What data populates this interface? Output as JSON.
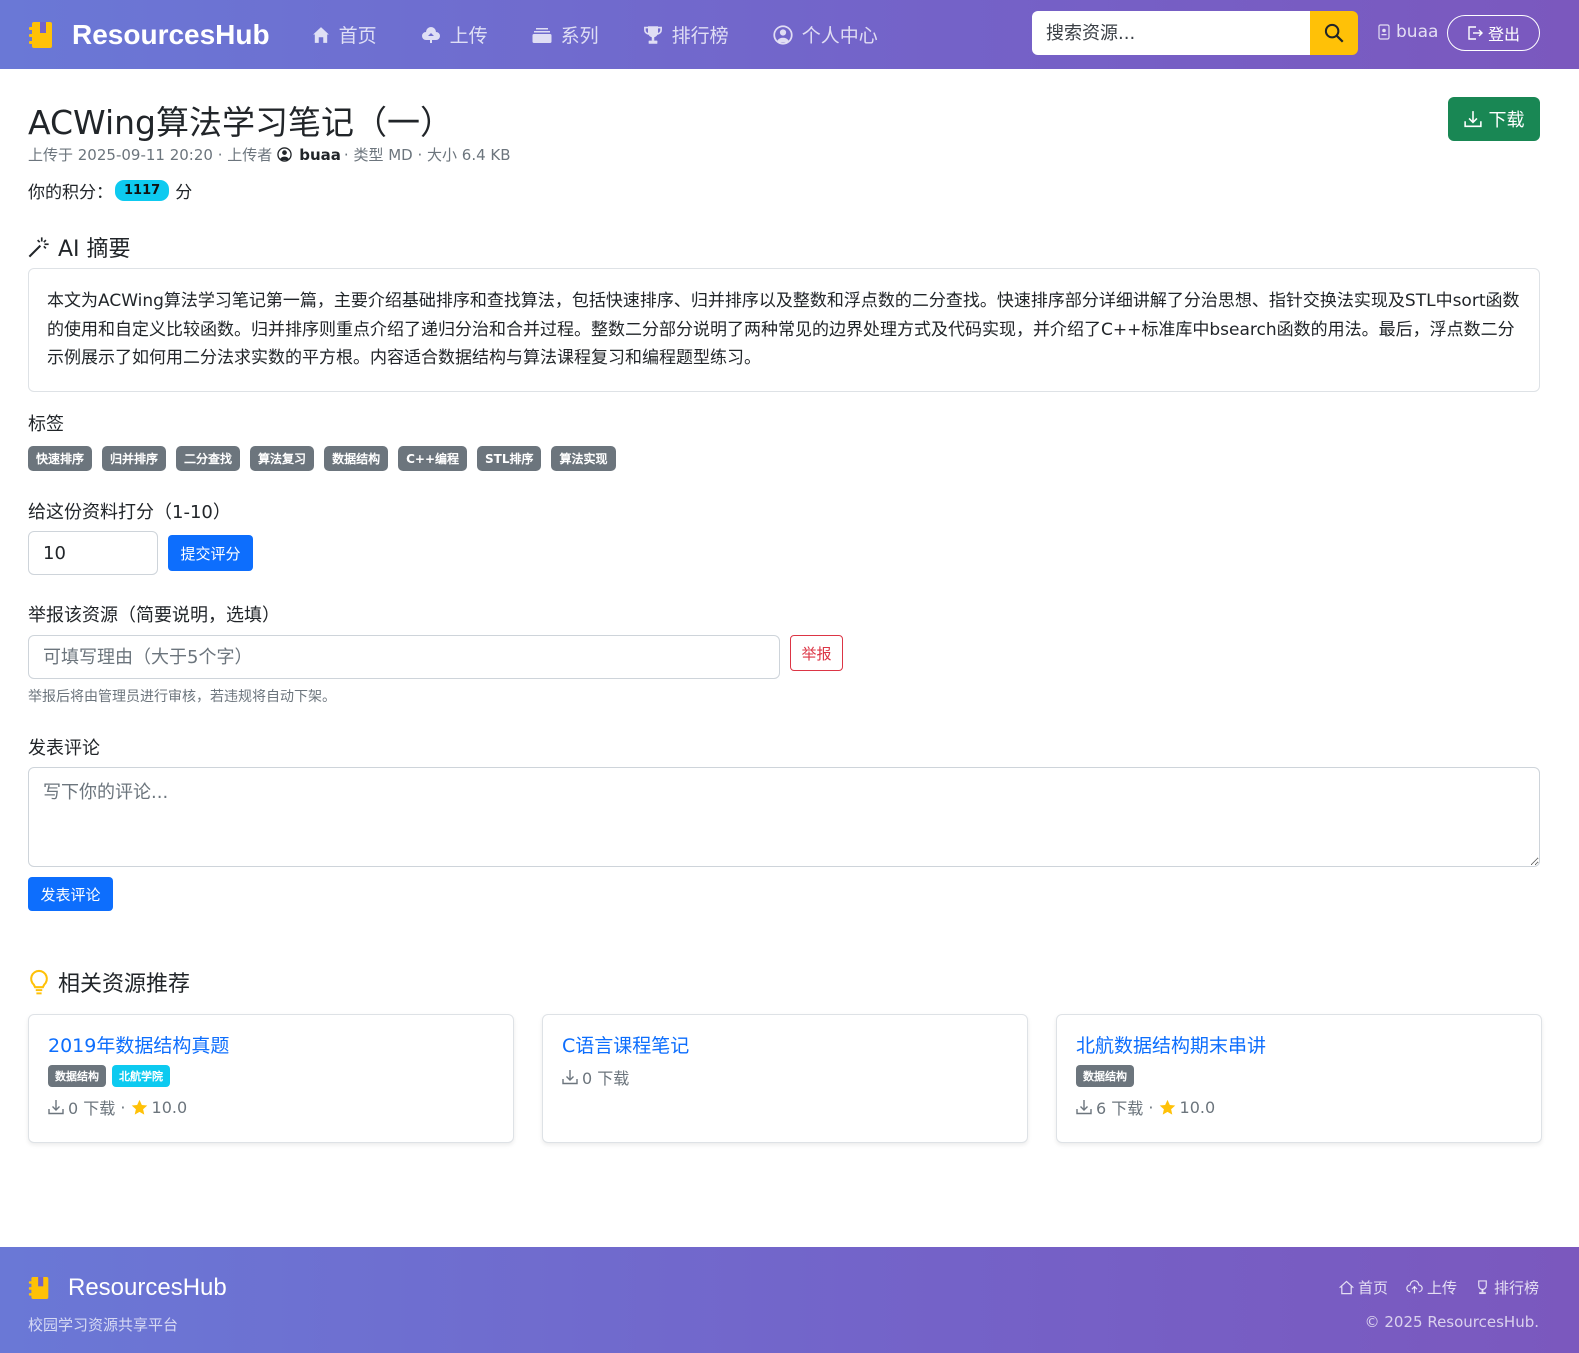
{
  "navbar": {
    "brand": "ResourcesHub",
    "links": [
      {
        "label": "首页",
        "icon": "home-icon"
      },
      {
        "label": "上传",
        "icon": "cloud-upload-icon"
      },
      {
        "label": "系列",
        "icon": "collection-icon"
      },
      {
        "label": "排行榜",
        "icon": "trophy-icon"
      },
      {
        "label": "个人中心",
        "icon": "person-circle-icon"
      }
    ],
    "search_placeholder": "搜索资源...",
    "username": "buaa",
    "logout_label": "登出"
  },
  "resource": {
    "title": "ACWing算法学习笔记（一）",
    "download_label": "下载",
    "meta_uploaded_prefix": "上传于 2025-09-11 20:20 · 上传者",
    "uploader": "buaa",
    "meta_suffix": "· 类型 MD · 大小 6.4 KB",
    "points_label": "你的积分：",
    "points_value": "1117",
    "points_unit": "分"
  },
  "ai_summary": {
    "heading": "AI 摘要",
    "text": "本文为ACWing算法学习笔记第一篇，主要介绍基础排序和查找算法，包括快速排序、归并排序以及整数和浮点数的二分查找。快速排序部分详细讲解了分治思想、指针交换法实现及STL中sort函数的使用和自定义比较函数。归并排序则重点介绍了递归分治和合并过程。整数二分部分说明了两种常见的边界处理方式及代码实现，并介绍了C++标准库中bsearch函数的用法。最后，浮点数二分示例展示了如何用二分法求实数的平方根。内容适合数据结构与算法课程复习和编程题型练习。"
  },
  "tags": {
    "heading": "标签",
    "items": [
      "快速排序",
      "归并排序",
      "二分查找",
      "算法复习",
      "数据结构",
      "C++编程",
      "STL排序",
      "算法实现"
    ]
  },
  "rating": {
    "label": "给这份资料打分（1-10）",
    "value": "10",
    "submit_label": "提交评分"
  },
  "report": {
    "label": "举报该资源（简要说明，选填）",
    "placeholder": "可填写理由（大于5个字）",
    "button_label": "举报",
    "hint": "举报后将由管理员进行审核，若违规将自动下架。"
  },
  "comment": {
    "label": "发表评论",
    "placeholder": "写下你的评论...",
    "submit_label": "发表评论"
  },
  "related": {
    "heading": "相关资源推荐",
    "cards": [
      {
        "title": "2019年数据结构真题",
        "tags": [
          {
            "label": "数据结构",
            "color": "#6c757d"
          },
          {
            "label": "北航学院",
            "color": "#0dcaf0"
          }
        ],
        "downloads": "0 下载",
        "has_rating": true,
        "rating": "10.0"
      },
      {
        "title": "C语言课程笔记",
        "tags": [],
        "downloads": "0 下载",
        "has_rating": false,
        "rating": ""
      },
      {
        "title": "北航数据结构期末串讲",
        "tags": [
          {
            "label": "数据结构",
            "color": "#6c757d"
          }
        ],
        "downloads": "6 下载",
        "has_rating": true,
        "rating": "10.0"
      }
    ]
  },
  "footer": {
    "brand": "ResourcesHub",
    "tagline": "校园学习资源共享平台",
    "links": [
      {
        "label": "首页",
        "icon": "home-icon"
      },
      {
        "label": "上传",
        "icon": "cloud-upload-icon"
      },
      {
        "label": "排行榜",
        "icon": "trophy-icon"
      }
    ],
    "copyright": "© 2025 ResourcesHub."
  },
  "colors": {
    "navbar_gradient_start": "#6a78d6",
    "navbar_gradient_end": "#7b58be",
    "accent_yellow": "#ffc107",
    "primary": "#0d6efd",
    "success": "#198754",
    "danger": "#dc3545",
    "info": "#0dcaf0",
    "tag_gray": "#6c757d"
  }
}
